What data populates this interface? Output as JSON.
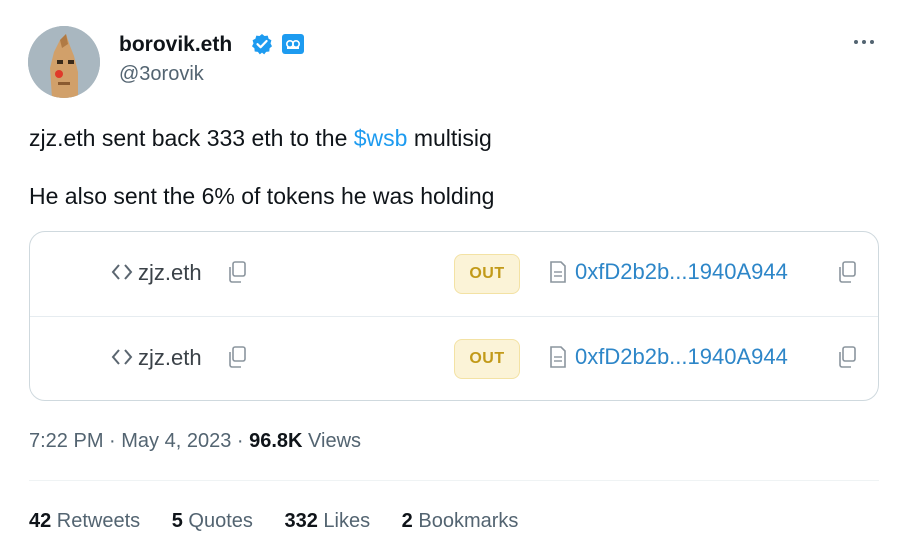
{
  "author": {
    "display_name": "borovik.eth",
    "handle": "@3orovik",
    "avatar": "punk-avatar",
    "verified_icon": "verified-badge-icon",
    "affiliation_icon": "affiliate-badge-icon"
  },
  "tweet": {
    "line1_before": "zjz.eth sent back 333 eth to the ",
    "cashtag": "$wsb",
    "line1_after": " multisig",
    "line2": "He also sent the 6% of tokens he was holding"
  },
  "transfers": [
    {
      "from": "zjz.eth",
      "direction": "OUT",
      "to": "0xfD2b2b...1940A944"
    },
    {
      "from": "zjz.eth",
      "direction": "OUT",
      "to": "0xfD2b2b...1940A944"
    }
  ],
  "meta": {
    "time": "7:22 PM",
    "dot1": " · ",
    "date": "May 4, 2023",
    "dot2": " · ",
    "views_count": "96.8K",
    "views_label": " Views"
  },
  "stats": {
    "retweets_count": "42",
    "retweets_label": " Retweets",
    "quotes_count": "5",
    "quotes_label": " Quotes",
    "likes_count": "332",
    "likes_label": " Likes",
    "bookmarks_count": "2",
    "bookmarks_label": " Bookmarks"
  },
  "colors": {
    "accent": "#1d9bf0",
    "out_badge_bg": "#fbf3d7",
    "out_badge_text": "#c29a19",
    "address": "#2d86c8"
  }
}
